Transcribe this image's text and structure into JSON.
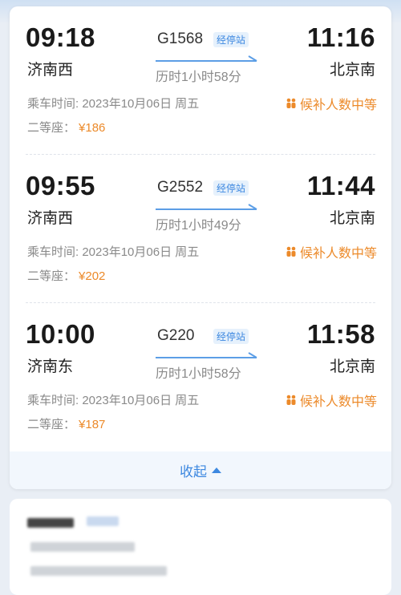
{
  "trains": [
    {
      "dep_time": "09:18",
      "dep_station": "济南西",
      "train_no": "G1568",
      "stops_label": "经停站",
      "duration": "历时1小时58分",
      "arr_time": "11:16",
      "arr_station": "北京南",
      "ride_date": "乘车时间: 2023年10月06日 周五",
      "seat_class": "二等座：",
      "price": "¥186",
      "waitlist": "候补人数中等"
    },
    {
      "dep_time": "09:55",
      "dep_station": "济南西",
      "train_no": "G2552",
      "stops_label": "经停站",
      "duration": "历时1小时49分",
      "arr_time": "11:44",
      "arr_station": "北京南",
      "ride_date": "乘车时间: 2023年10月06日 周五",
      "seat_class": "二等座：",
      "price": "¥202",
      "waitlist": "候补人数中等"
    },
    {
      "dep_time": "10:00",
      "dep_station": "济南东",
      "train_no": "G220",
      "stops_label": "经停站",
      "duration": "历时1小时58分",
      "arr_time": "11:58",
      "arr_station": "北京南",
      "ride_date": "乘车时间: 2023年10月06日 周五",
      "seat_class": "二等座：",
      "price": "¥187",
      "waitlist": "候补人数中等"
    }
  ],
  "collapse_label": "收起",
  "icons": {
    "waitlist": "people-icon",
    "arrow": "direction-arrow-icon",
    "collapse": "caret-up-icon"
  },
  "colors": {
    "accent_blue": "#3d88e0",
    "price_orange": "#ec8a2a",
    "text_gray": "#8a8a8a"
  }
}
